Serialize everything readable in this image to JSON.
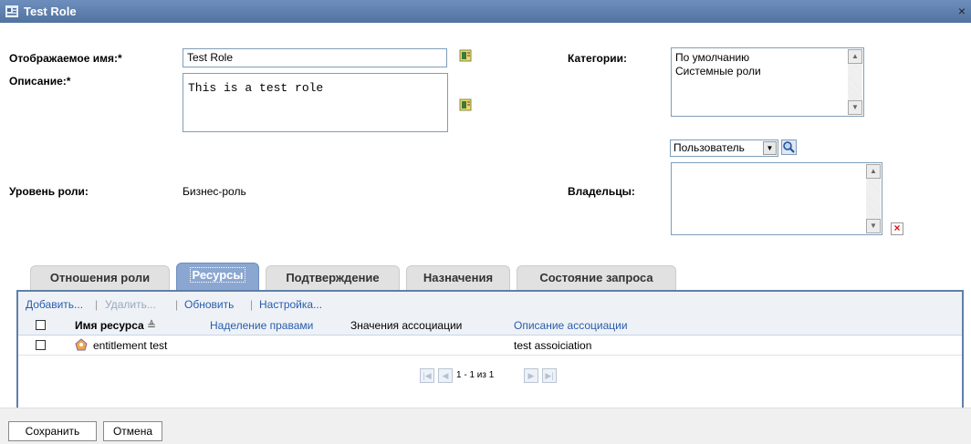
{
  "window": {
    "title": "Test Role",
    "close_glyph": "×"
  },
  "fields": {
    "display_name_label": "Отображаемое имя:*",
    "display_name_value": "Test Role",
    "description_label": "Описание:*",
    "description_value": "This is a test role",
    "role_level_label": "Уровень роли:",
    "role_level_value": "Бизнес-роль",
    "categories_label": "Категории:",
    "categories": [
      "По умолчанию",
      "Системные роли"
    ],
    "owners_label": "Владельцы:",
    "owner_type_selected": "Пользователь"
  },
  "tabs": [
    {
      "label": "Отношения роли",
      "active": false
    },
    {
      "label": "Ресурсы",
      "active": true
    },
    {
      "label": "Подтверждение",
      "active": false
    },
    {
      "label": "Назначения",
      "active": false
    },
    {
      "label": "Состояние запроса",
      "active": false
    }
  ],
  "toolbar": {
    "add": "Добавить...",
    "remove": "Удалить...",
    "refresh": "Обновить",
    "settings": "Настройка...",
    "separator": "|"
  },
  "table": {
    "columns": [
      "Имя ресурса",
      "Наделение правами",
      "Значения ассоциации",
      "Описание ассоциации"
    ],
    "sort_indicator": "≜",
    "rows": [
      {
        "name": "entitlement test",
        "entitlement": "",
        "assoc_values": "",
        "assoc_description": "test assoiciation"
      }
    ]
  },
  "pager": {
    "text": "1 - 1 из 1"
  },
  "buttons": {
    "save": "Сохранить",
    "cancel": "Отмена"
  },
  "icons": {
    "title": "role-icon",
    "localize": "localize-book-icon",
    "search": "search-icon",
    "delete": "delete-icon",
    "resource": "resource-icon"
  },
  "colors": {
    "titlebar": "#5f7fa8",
    "active_tab": "#8aa6d1",
    "link": "#2a5caa",
    "delete": "#d11111"
  }
}
